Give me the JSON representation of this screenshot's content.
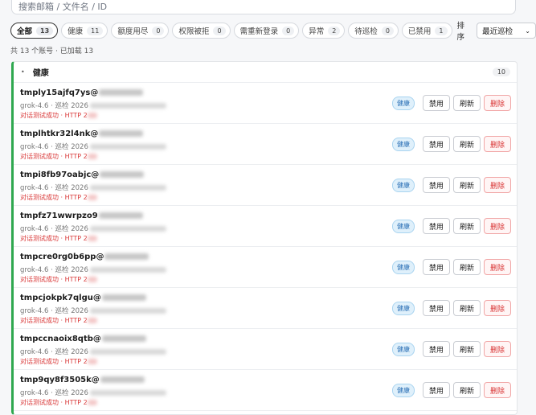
{
  "search": {
    "placeholder": "搜索邮箱 / 文件名 / ID"
  },
  "filters": [
    {
      "label": "全部",
      "count": "13",
      "active": true,
      "name": "filter-all"
    },
    {
      "label": "健康",
      "count": "11",
      "active": false,
      "name": "filter-healthy"
    },
    {
      "label": "额度用尽",
      "count": "0",
      "active": false,
      "name": "filter-quota-exhausted"
    },
    {
      "label": "权限被拒",
      "count": "0",
      "active": false,
      "name": "filter-permission-denied"
    },
    {
      "label": "需重新登录",
      "count": "0",
      "active": false,
      "name": "filter-relogin"
    },
    {
      "label": "异常",
      "count": "2",
      "active": false,
      "name": "filter-abnormal"
    },
    {
      "label": "待巡检",
      "count": "0",
      "active": false,
      "name": "filter-pending-check"
    },
    {
      "label": "已禁用",
      "count": "1",
      "active": false,
      "name": "filter-disabled"
    }
  ],
  "sort": {
    "label": "排序",
    "selected": "最近巡检"
  },
  "summary": "共 13 个账号 · 已加载 13",
  "group": {
    "title": "健康",
    "count": "10"
  },
  "row_meta_prefix": "grok-4.6 · 巡检 2026",
  "row_test_text": "对话测试成功 · HTTP 2",
  "row_actions": {
    "badge": "健康",
    "disable": "禁用",
    "refresh": "刷新",
    "delete": "删除"
  },
  "accounts": [
    {
      "name": "tmply15ajfq7ys@"
    },
    {
      "name": "tmplhtkr32l4nk@"
    },
    {
      "name": "tmpi8fb97oabjc@"
    },
    {
      "name": "tmpfz71wwrpzo9"
    },
    {
      "name": "tmpcre0rg0b6pp@"
    },
    {
      "name": "tmpcjokpk7qlgu@"
    },
    {
      "name": "tmpccnaoix8qtb@"
    },
    {
      "name": "tmp9qy8f3505k@"
    }
  ]
}
